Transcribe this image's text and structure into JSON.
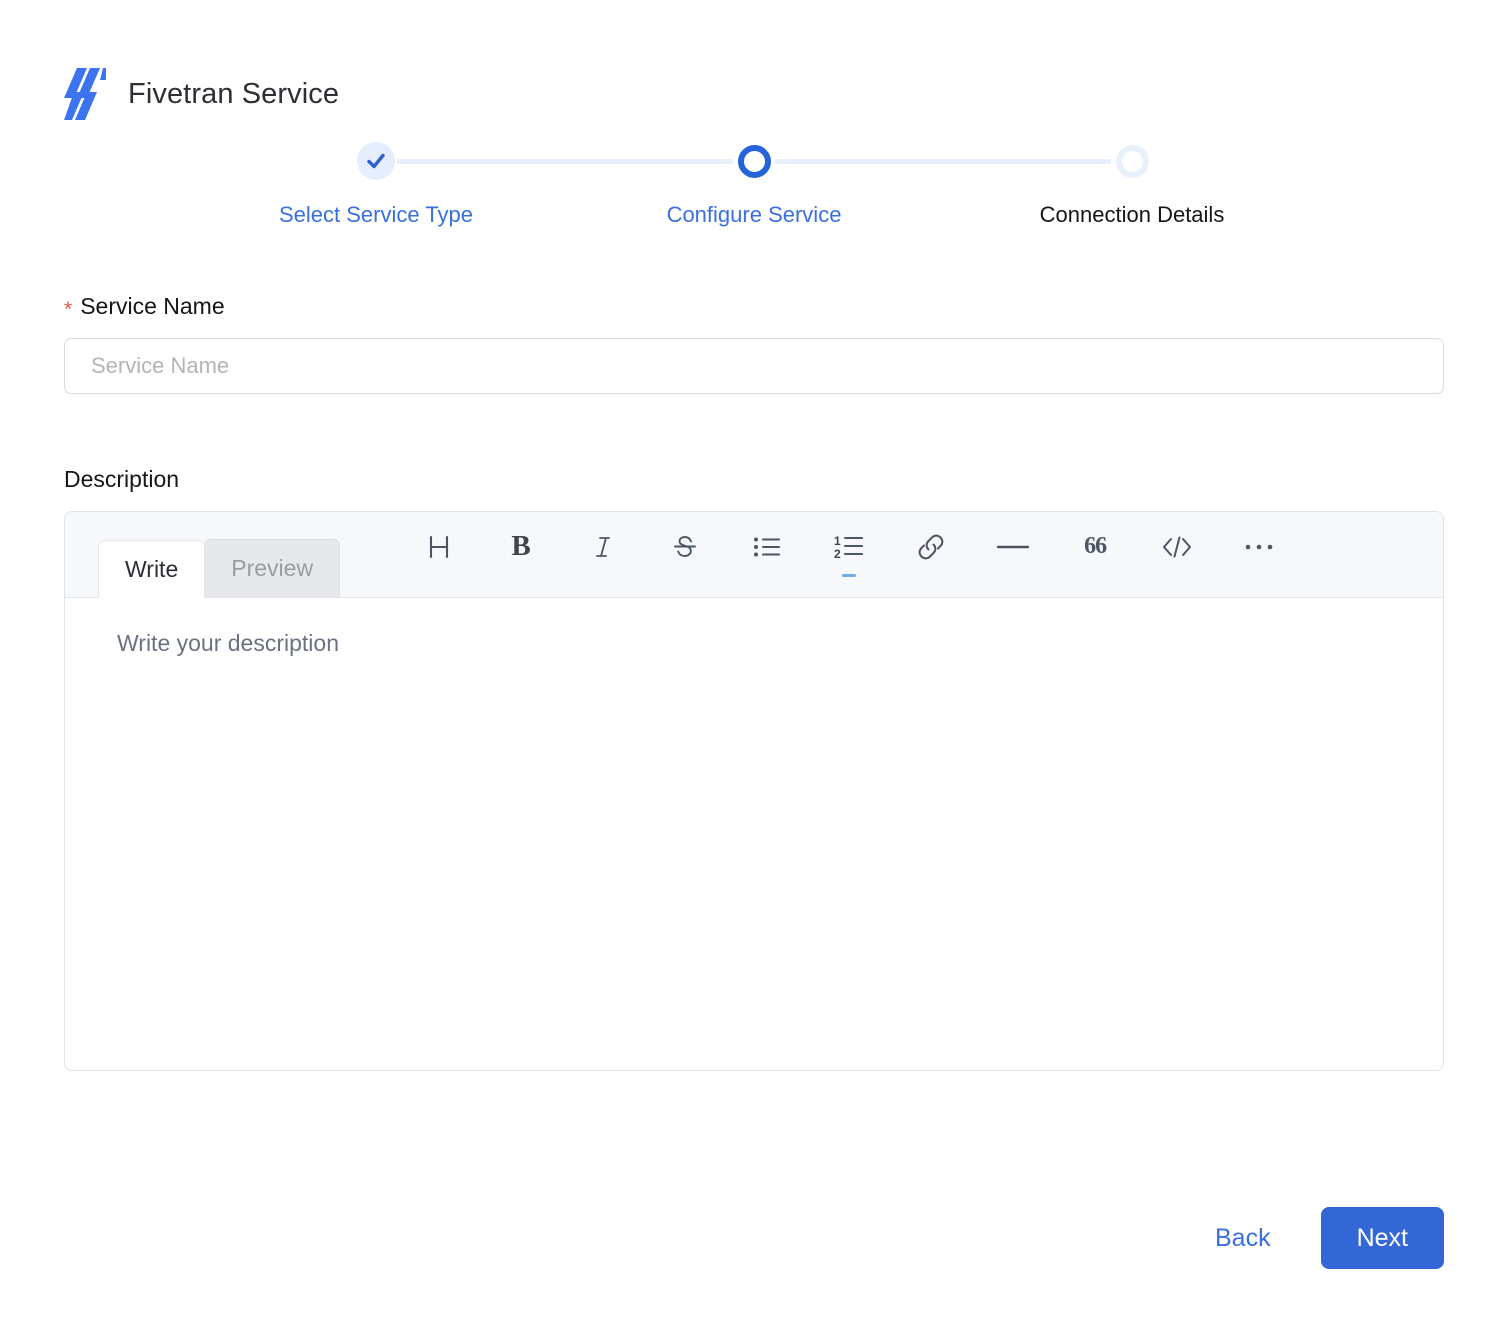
{
  "header": {
    "title": "Fivetran Service",
    "logo_icon": "fivetran-logo-icon",
    "logo_color": "#3c74f0"
  },
  "stepper": {
    "steps": [
      {
        "label": "Select Service Type",
        "state": "done",
        "icon": "check-icon"
      },
      {
        "label": "Configure Service",
        "state": "active",
        "icon": "circle-icon"
      },
      {
        "label": "Connection Details",
        "state": "todo",
        "icon": "circle-icon"
      }
    ],
    "active_color": "#2563d9",
    "done_fill": "#e4eefc",
    "todo_ring": "#e8f0fb",
    "connector_color": "#e8f0fd",
    "label_link_color": "#3a6fe0",
    "label_plain_color": "#16161a"
  },
  "service_name": {
    "label": "Service Name",
    "required_marker": "*",
    "required_color": "#e5534b",
    "value": "",
    "placeholder": "Service Name"
  },
  "description": {
    "label": "Description",
    "tabs": [
      {
        "label": "Write",
        "active": true
      },
      {
        "label": "Preview",
        "active": false
      }
    ],
    "toolbar": [
      {
        "name": "heading-icon",
        "glyph": "H"
      },
      {
        "name": "bold-icon",
        "glyph": "B"
      },
      {
        "name": "italic-icon",
        "glyph": "I"
      },
      {
        "name": "strikethrough-icon",
        "glyph": "S"
      },
      {
        "name": "bullet-list-icon",
        "glyph": ""
      },
      {
        "name": "numbered-list-icon",
        "glyph": "1 2"
      },
      {
        "name": "link-icon",
        "glyph": ""
      },
      {
        "name": "horizontal-rule-icon",
        "glyph": "—"
      },
      {
        "name": "blockquote-icon",
        "glyph": "66"
      },
      {
        "name": "code-icon",
        "glyph": "</>"
      },
      {
        "name": "more-options-icon",
        "glyph": "•••"
      }
    ],
    "placeholder": "Write your description",
    "value": ""
  },
  "footer": {
    "back_label": "Back",
    "next_label": "Next",
    "next_bg": "#3367d6",
    "back_color": "#3a6fe0"
  }
}
